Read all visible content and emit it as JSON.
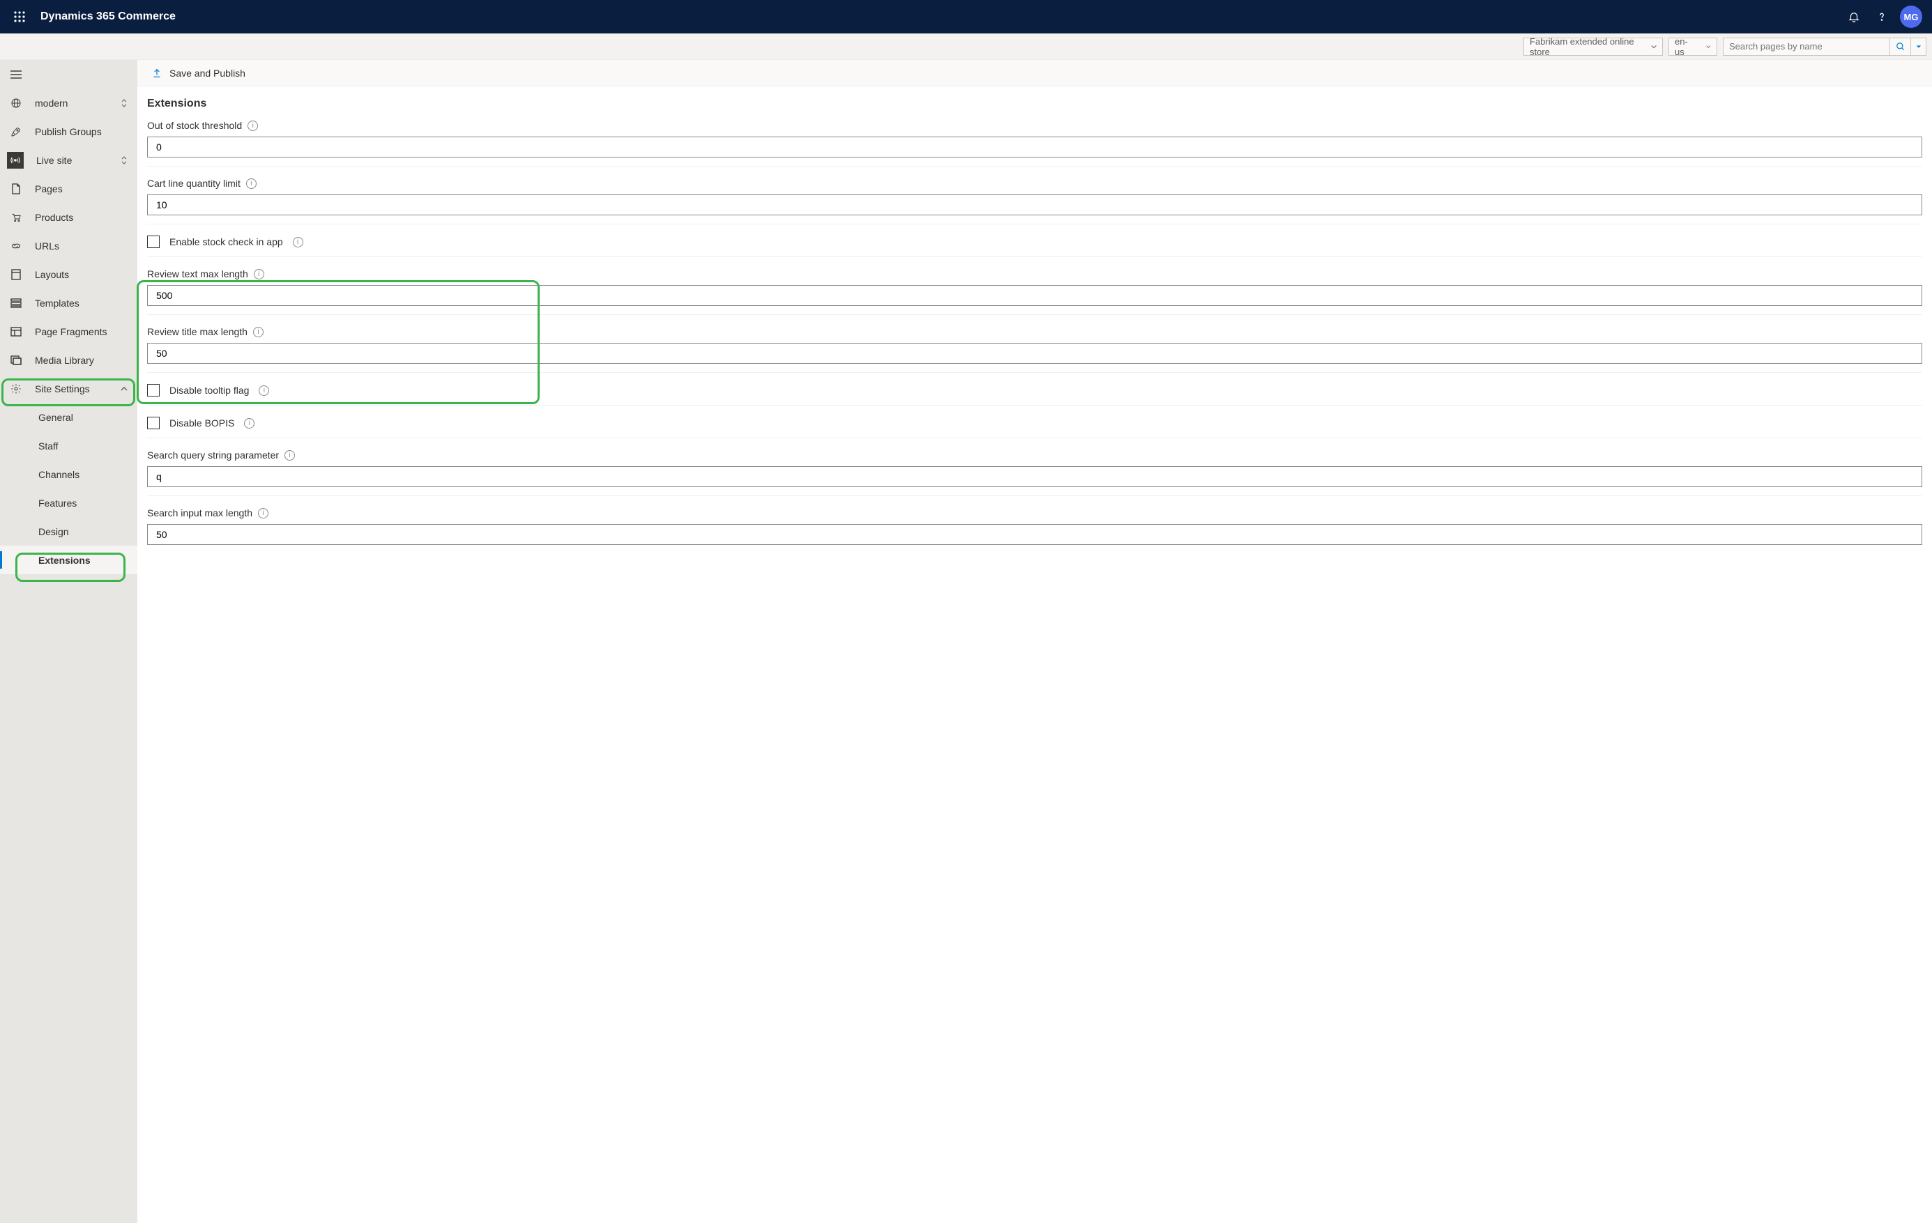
{
  "header": {
    "product_name": "Dynamics 365 Commerce",
    "avatar_initials": "MG"
  },
  "context": {
    "store_selector": "Fabrikam extended online store",
    "locale_selector": "en-us",
    "search_placeholder": "Search pages by name"
  },
  "command_bar": {
    "save_publish": "Save and Publish"
  },
  "sidebar": {
    "modern": "modern",
    "publish_groups": "Publish Groups",
    "live_site": "Live site",
    "pages": "Pages",
    "products": "Products",
    "urls": "URLs",
    "layouts": "Layouts",
    "templates": "Templates",
    "fragments": "Page Fragments",
    "media": "Media Library",
    "site_settings": "Site Settings",
    "general": "General",
    "staff": "Staff",
    "channels": "Channels",
    "features": "Features",
    "design": "Design",
    "extensions": "Extensions"
  },
  "page": {
    "title": "Extensions",
    "fields": {
      "out_of_stock_label": "Out of stock threshold",
      "out_of_stock_value": "0",
      "cart_limit_label": "Cart line quantity limit",
      "cart_limit_value": "10",
      "enable_stock_check_label": "Enable stock check in app",
      "review_text_label": "Review text max length",
      "review_text_value": "500",
      "review_title_label": "Review title max length",
      "review_title_value": "50",
      "disable_tooltip_label": "Disable tooltip flag",
      "disable_bopis_label": "Disable BOPIS",
      "search_query_label": "Search query string parameter",
      "search_query_value": "q",
      "search_maxlen_label": "Search input max length",
      "search_maxlen_value": "50"
    }
  }
}
